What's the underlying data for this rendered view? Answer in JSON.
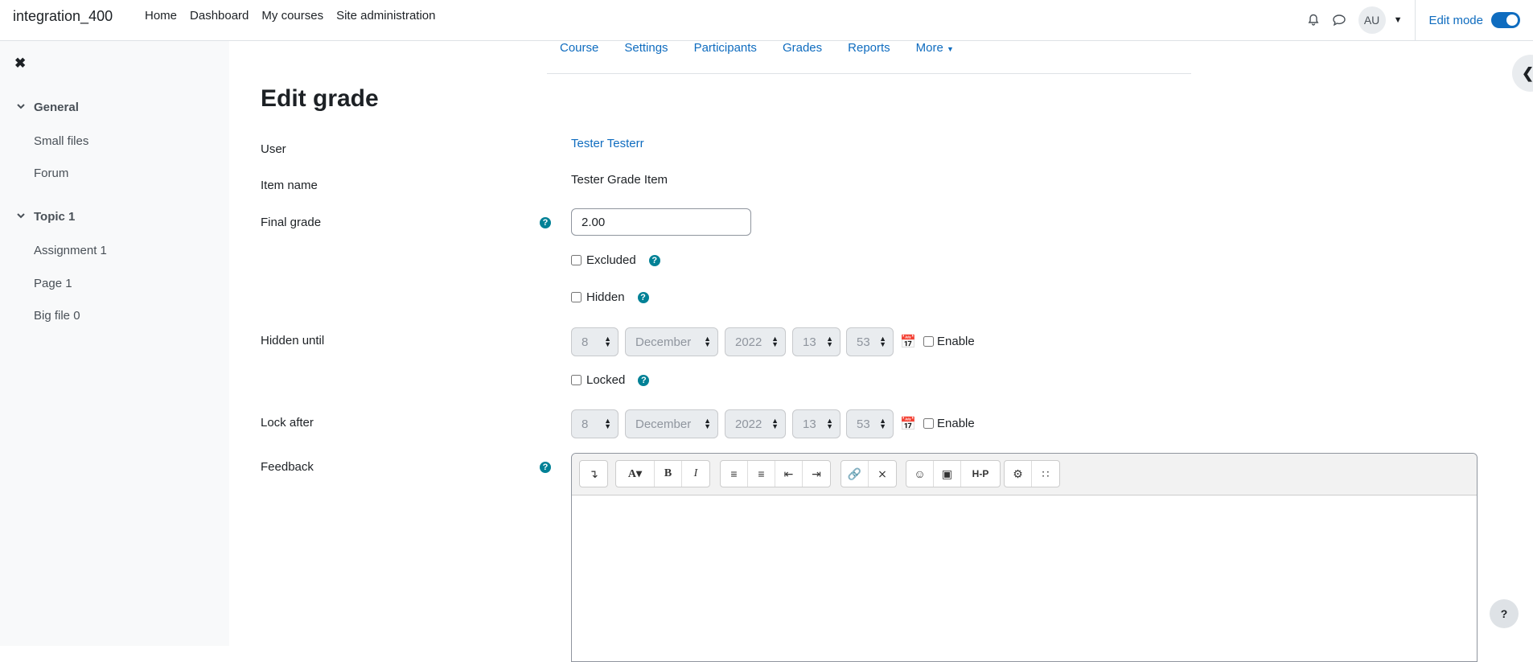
{
  "navbar": {
    "site_name": "integration_400",
    "links": [
      "Home",
      "Dashboard",
      "My courses",
      "Site administration"
    ],
    "user_initials": "AU",
    "edit_mode_label": "Edit mode",
    "edit_mode_on": true
  },
  "drawer": {
    "sections": [
      {
        "title": "General",
        "items": [
          "Small files",
          "Forum"
        ]
      },
      {
        "title": "Topic 1",
        "items": [
          "Assignment 1",
          "Page 1",
          "Big file 0"
        ]
      }
    ]
  },
  "secondary_nav": {
    "items": [
      "Course",
      "Settings",
      "Participants",
      "Grades",
      "Reports"
    ],
    "more_label": "More"
  },
  "page_title": "Edit grade",
  "form": {
    "user_label": "User",
    "user_value": "Tester Testerr",
    "item_name_label": "Item name",
    "item_name_value": "Tester Grade Item",
    "final_grade_label": "Final grade",
    "final_grade_value": "2.00",
    "excluded_label": "Excluded",
    "hidden_label": "Hidden",
    "hidden_until_label": "Hidden until",
    "hidden_until": {
      "day": "8",
      "month": "December",
      "year": "2022",
      "hour": "13",
      "minute": "53",
      "enable_label": "Enable"
    },
    "locked_label": "Locked",
    "lock_after_label": "Lock after",
    "lock_after": {
      "day": "8",
      "month": "December",
      "year": "2022",
      "hour": "13",
      "minute": "53",
      "enable_label": "Enable"
    },
    "feedback_label": "Feedback"
  },
  "editor_toolbar": {
    "groups": [
      [
        "collapse-icon"
      ],
      [
        "font-style-icon",
        "bold-icon",
        "italic-icon"
      ],
      [
        "unordered-list-icon",
        "ordered-list-icon",
        "outdent-icon",
        "indent-icon"
      ],
      [
        "link-icon",
        "unlink-icon"
      ],
      [
        "emoji-icon",
        "image-icon",
        "h5p-icon"
      ],
      [
        "accessibility-checker-icon",
        "screenreader-helper-icon"
      ]
    ],
    "h5p_text": "H-P"
  },
  "help_fab_label": "?"
}
